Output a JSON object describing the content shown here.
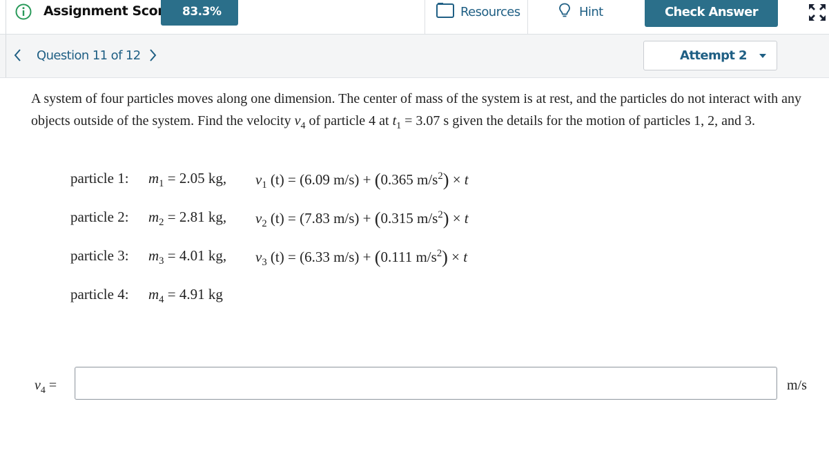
{
  "header": {
    "score_label": "Assignment Score:",
    "score_value": "83.3%",
    "resources_label": "Resources",
    "hint_label": "Hint",
    "check_answer_label": "Check Answer"
  },
  "nav": {
    "question_label": "Question 11 of 12",
    "attempt_label": "Attempt 2"
  },
  "question": {
    "intro_1": "A system of four particles moves along one dimension. The center of mass of the system is at rest, and the particles do not interact with any objects outside of the system. Find the velocity ",
    "velocity_symbol": "v",
    "velocity_sub": "4",
    "intro_2": " of particle 4 at ",
    "time_symbol": "t",
    "time_sub": "1",
    "time_value": " = 3.07 s",
    "intro_3": " given the details for the motion of particles 1, 2, and 3."
  },
  "particles": [
    {
      "name": "particle 1:",
      "mass_sub": "1",
      "mass": " = 2.05 kg,",
      "vel_sub": "1",
      "v0": " (t) = (6.09 m/s) + ",
      "accel": "0.365 m/s",
      "accel_exp": "2"
    },
    {
      "name": "particle 2:",
      "mass_sub": "2",
      "mass": " = 2.81 kg,",
      "vel_sub": "2",
      "v0": " (t) = (7.83 m/s) + ",
      "accel": "0.315 m/s",
      "accel_exp": "2"
    },
    {
      "name": "particle 3:",
      "mass_sub": "3",
      "mass": " = 4.01 kg,",
      "vel_sub": "3",
      "v0": " (t) = (6.33 m/s) + ",
      "accel": "0.111 m/s",
      "accel_exp": "2"
    },
    {
      "name": "particle 4:",
      "mass_sub": "4",
      "mass": " = 4.91 kg"
    }
  ],
  "answer": {
    "label_symbol": "v",
    "label_sub": "4",
    "label_eq": " =",
    "value": "",
    "placeholder": "",
    "unit": "m/s"
  },
  "colors": {
    "primary": "#2b6f8a",
    "link": "#1f5f84",
    "toolbar_bg": "#f4f5f6"
  }
}
